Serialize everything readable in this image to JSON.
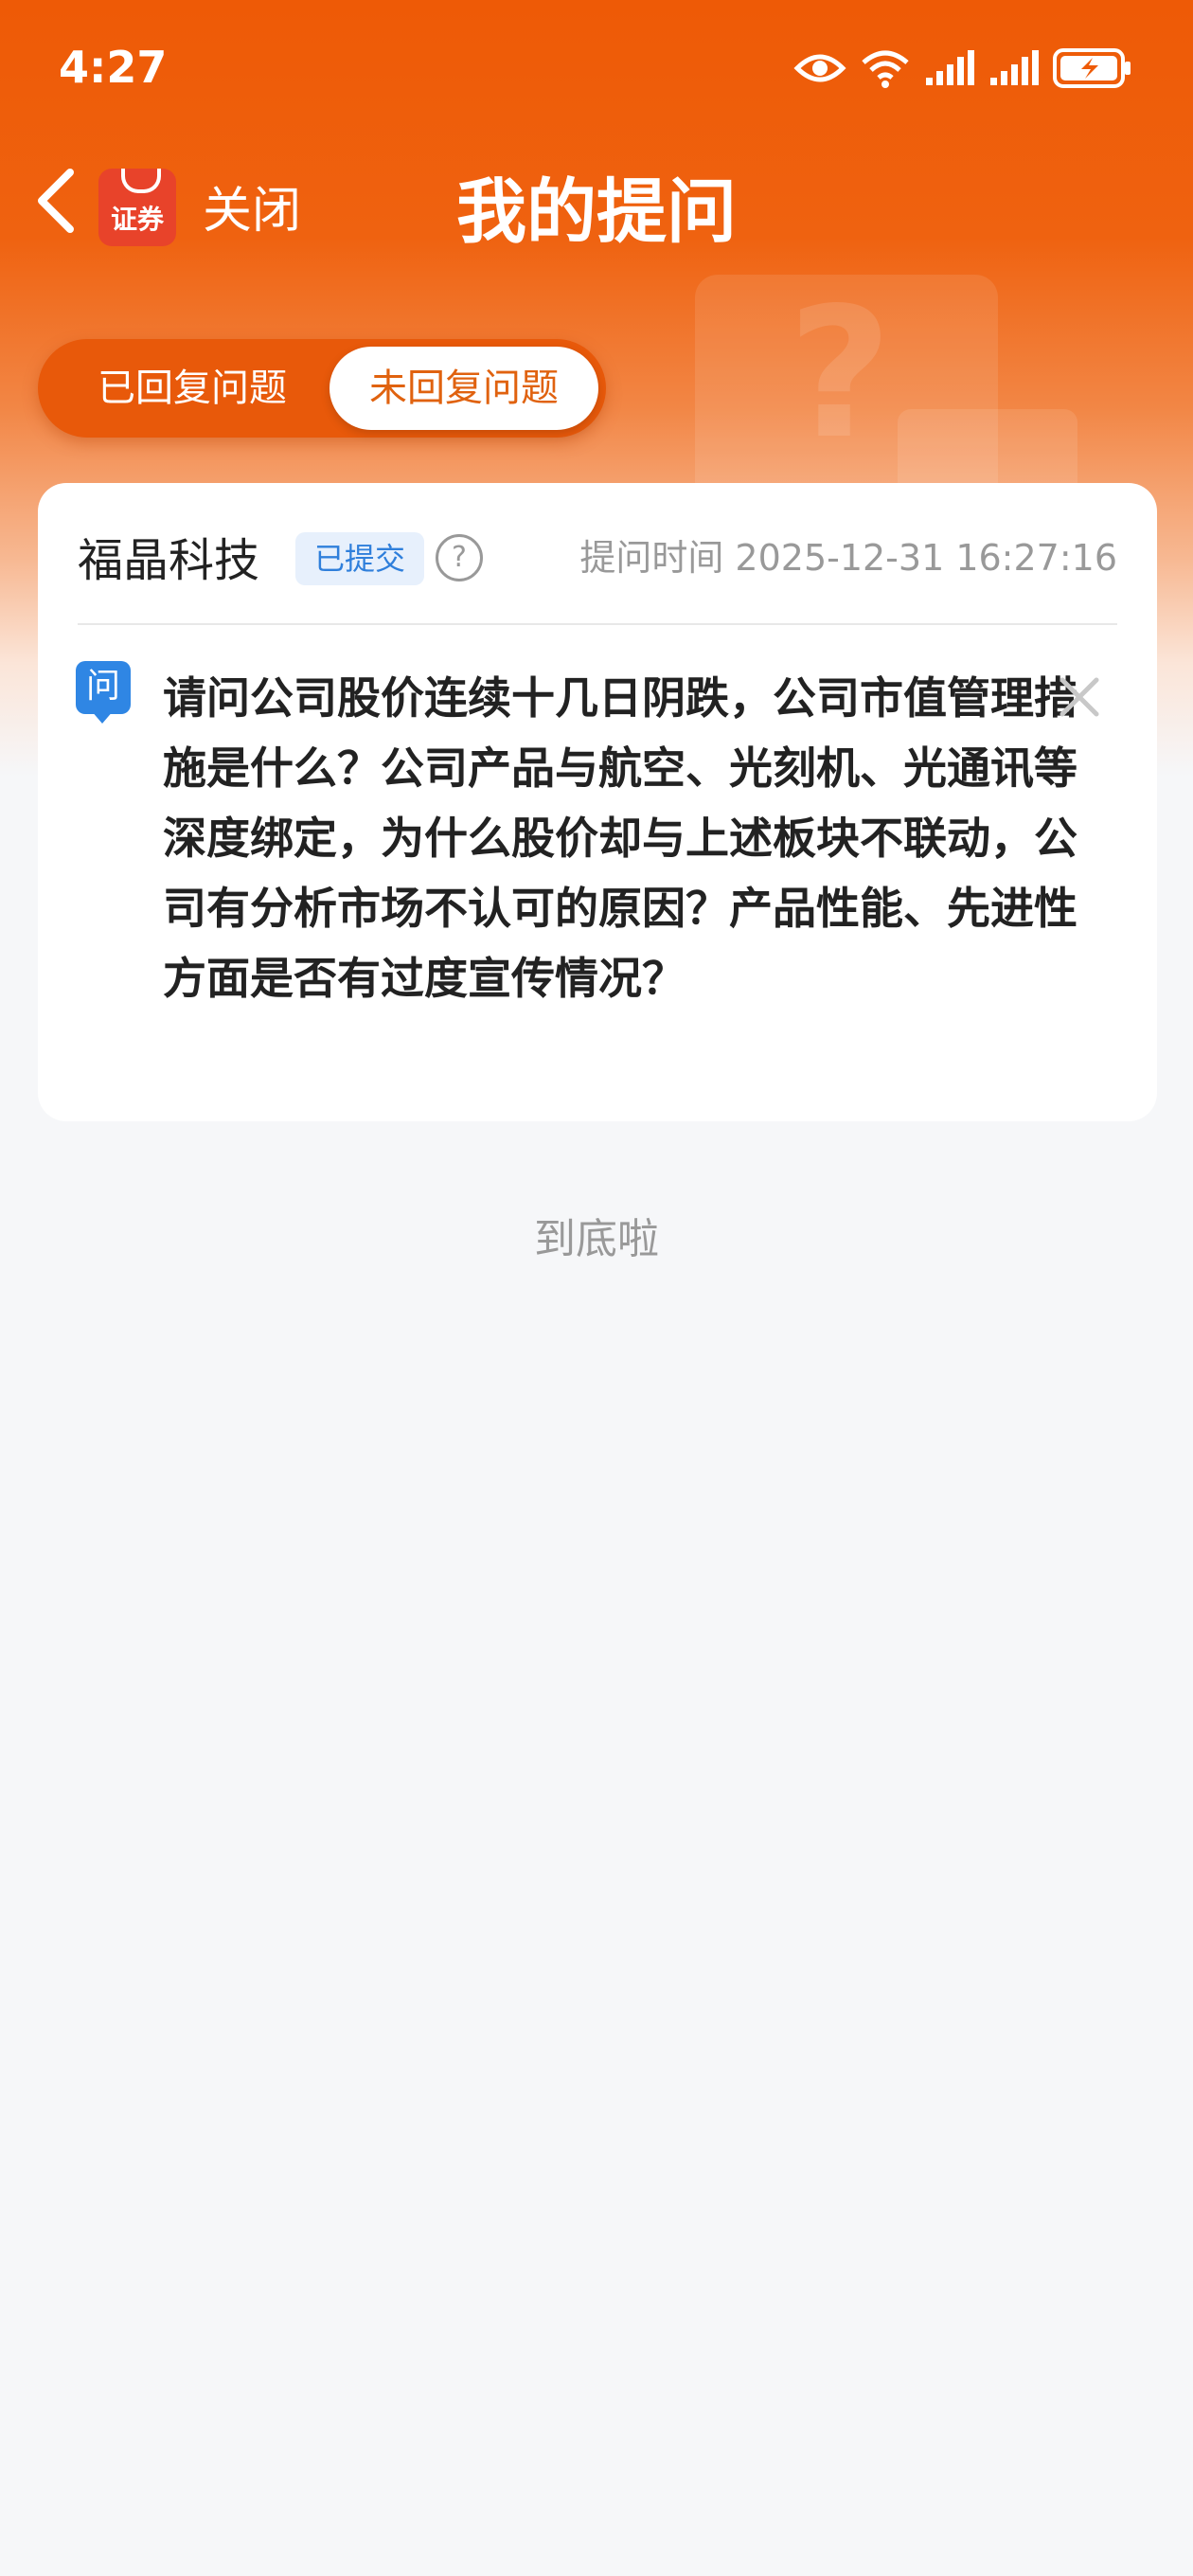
{
  "status_bar": {
    "time": "4:27"
  },
  "header": {
    "logo_text": "证券",
    "close_label": "关闭",
    "title": "我的提问"
  },
  "tabs": [
    {
      "label": "已回复问题",
      "active": false
    },
    {
      "label": "未回复问题",
      "active": true
    }
  ],
  "question_card": {
    "company": "福晶科技",
    "status_badge": "已提交",
    "help_symbol": "?",
    "time_label": "提问时间 2025-12-31 16:27:16",
    "question_icon": "问",
    "question_text": "请问公司股价连续十几日阴跌，公司市值管理措施是什么？公司产品与航空、光刻机、光通讯等深度绑定，为什么股价却与上述板块不联动，公司有分析市场不认可的原因？产品性能、先进性方面是否有过度宣传情况？"
  },
  "footer": {
    "end_text": "到底啦"
  },
  "colors": {
    "brand_orange": "#ee5a06",
    "badge_blue": "#2f7fdb",
    "icon_blue": "#2f86e4"
  }
}
